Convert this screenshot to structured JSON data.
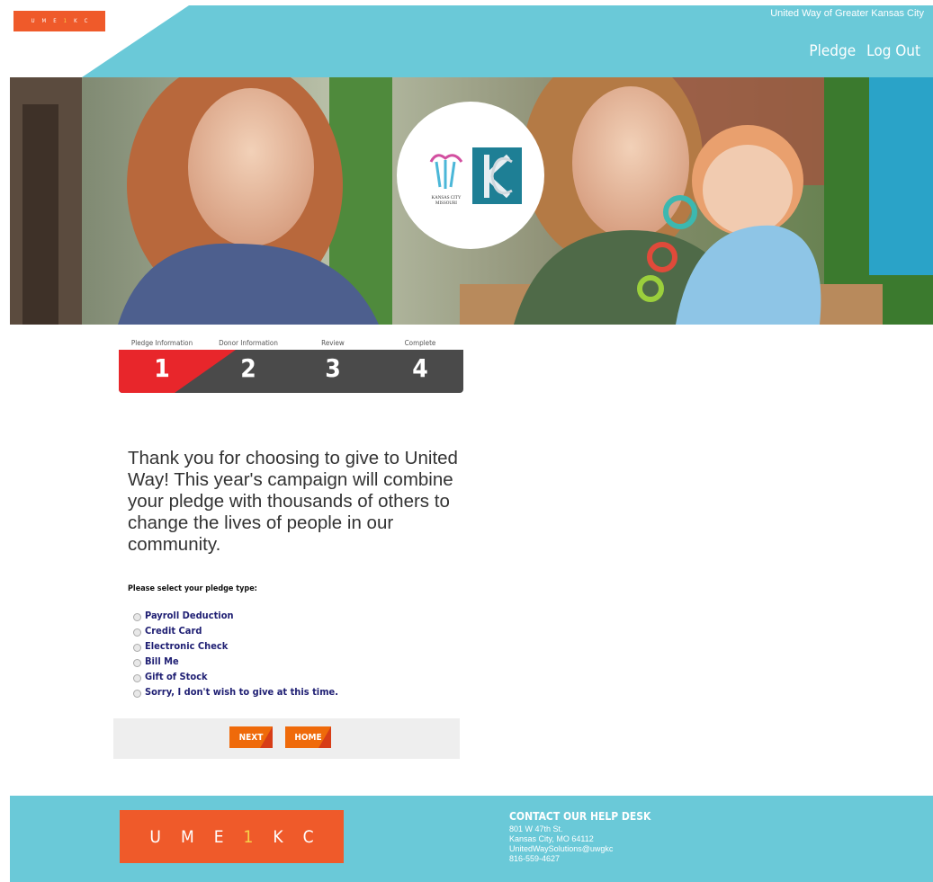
{
  "header": {
    "logo_letters": [
      "U",
      "M",
      "E",
      "1",
      "K",
      "C"
    ],
    "org_name": "United Way of Greater Kansas City",
    "nav": [
      {
        "label": "Pledge"
      },
      {
        "label": "Log Out"
      }
    ]
  },
  "hero": {
    "kc_text_line1": "KANSAS CITY",
    "kc_text_line2": "MISSOURI"
  },
  "steps": [
    {
      "label": "Pledge Information",
      "number": "1",
      "active": true
    },
    {
      "label": "Donor Information",
      "number": "2",
      "active": false
    },
    {
      "label": "Review",
      "number": "3",
      "active": false
    },
    {
      "label": "Complete",
      "number": "4",
      "active": false
    }
  ],
  "intro": "Thank you for choosing to give to United Way! This year's campaign will combine your pledge with thousands of others to change the lives of people in our community.",
  "pledge_prompt": "Please select your pledge type:",
  "pledge_options": [
    {
      "label": "Payroll Deduction"
    },
    {
      "label": "Credit Card"
    },
    {
      "label": "Electronic Check"
    },
    {
      "label": "Bill Me"
    },
    {
      "label": "Gift of Stock"
    },
    {
      "label": "Sorry, I don't wish to give at this time."
    }
  ],
  "buttons": {
    "next": "NEXT",
    "home": "HOME"
  },
  "footer": {
    "logo_letters": [
      "U",
      "M",
      "E",
      "1",
      "K",
      "C"
    ],
    "help_title": "CONTACT OUR HELP DESK",
    "address1": "801 W 47th St.",
    "address2": "Kansas City, MO 64112",
    "email": "UnitedWaySolutions@uwgkc",
    "phone": "816-559-4627"
  },
  "colors": {
    "teal": "#6ac9d8",
    "orange": "#ef5a2a",
    "active_step": "#e8262b",
    "button": "#ef6a0a"
  }
}
